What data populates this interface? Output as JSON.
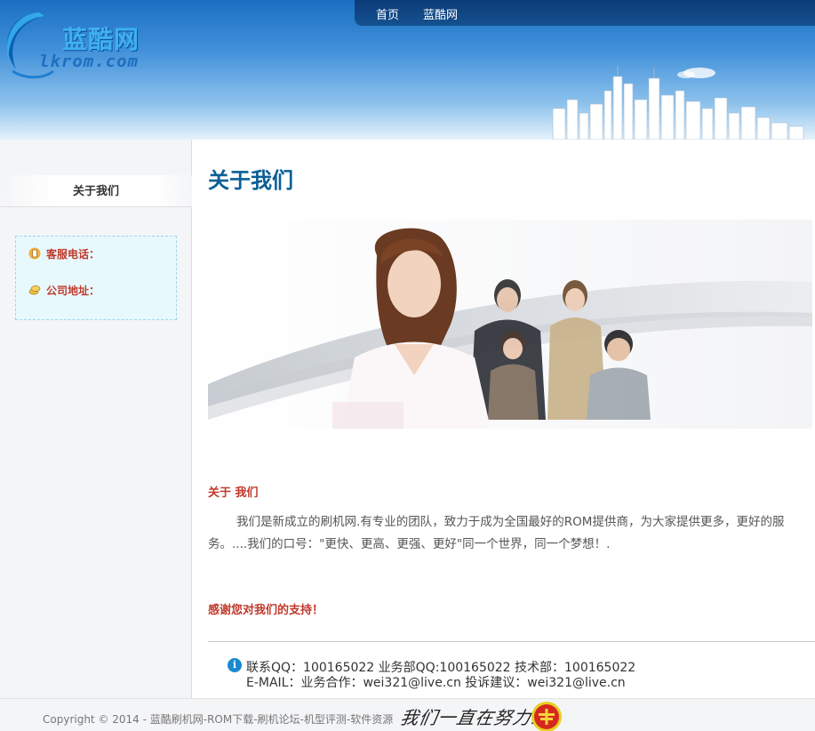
{
  "header": {
    "logo_cn": "蓝酷网",
    "logo_en": "lkrom.com",
    "nav": [
      {
        "label": "首页"
      },
      {
        "label": "蓝酷网"
      }
    ]
  },
  "sidebar": {
    "title": "关于我们",
    "contact": {
      "phone_label": "客服电话：",
      "address_label": "公司地址："
    }
  },
  "main": {
    "title": "关于我们",
    "about_heading": "关于 我们",
    "about_body": "我们是新成立的刷机网.有专业的团队，致力于成为全国最好的ROM提供商，为大家提供更多，更好的服务。....我们的口号：\"更快、更高、更强、更好\"同一个世界，同一个梦想！.",
    "thanks": "感谢您对我们的支持！",
    "contact_line1": "联系QQ：100165022 业务部QQ:100165022 技术部：100165022",
    "contact_line2": "E-MAIL：业务合作：wei321@live.cn 投诉建议：wei321@live.cn"
  },
  "footer": {
    "copyright": "Copyright © 2014 - 蓝酷刷机网-ROM下载-刷机论坛-机型评测-软件资源",
    "slogan": "我们一直在努力!"
  },
  "colors": {
    "accent_blue": "#0b5f96",
    "accent_red": "#c0392b",
    "nav_bg": "#0b3b78"
  }
}
